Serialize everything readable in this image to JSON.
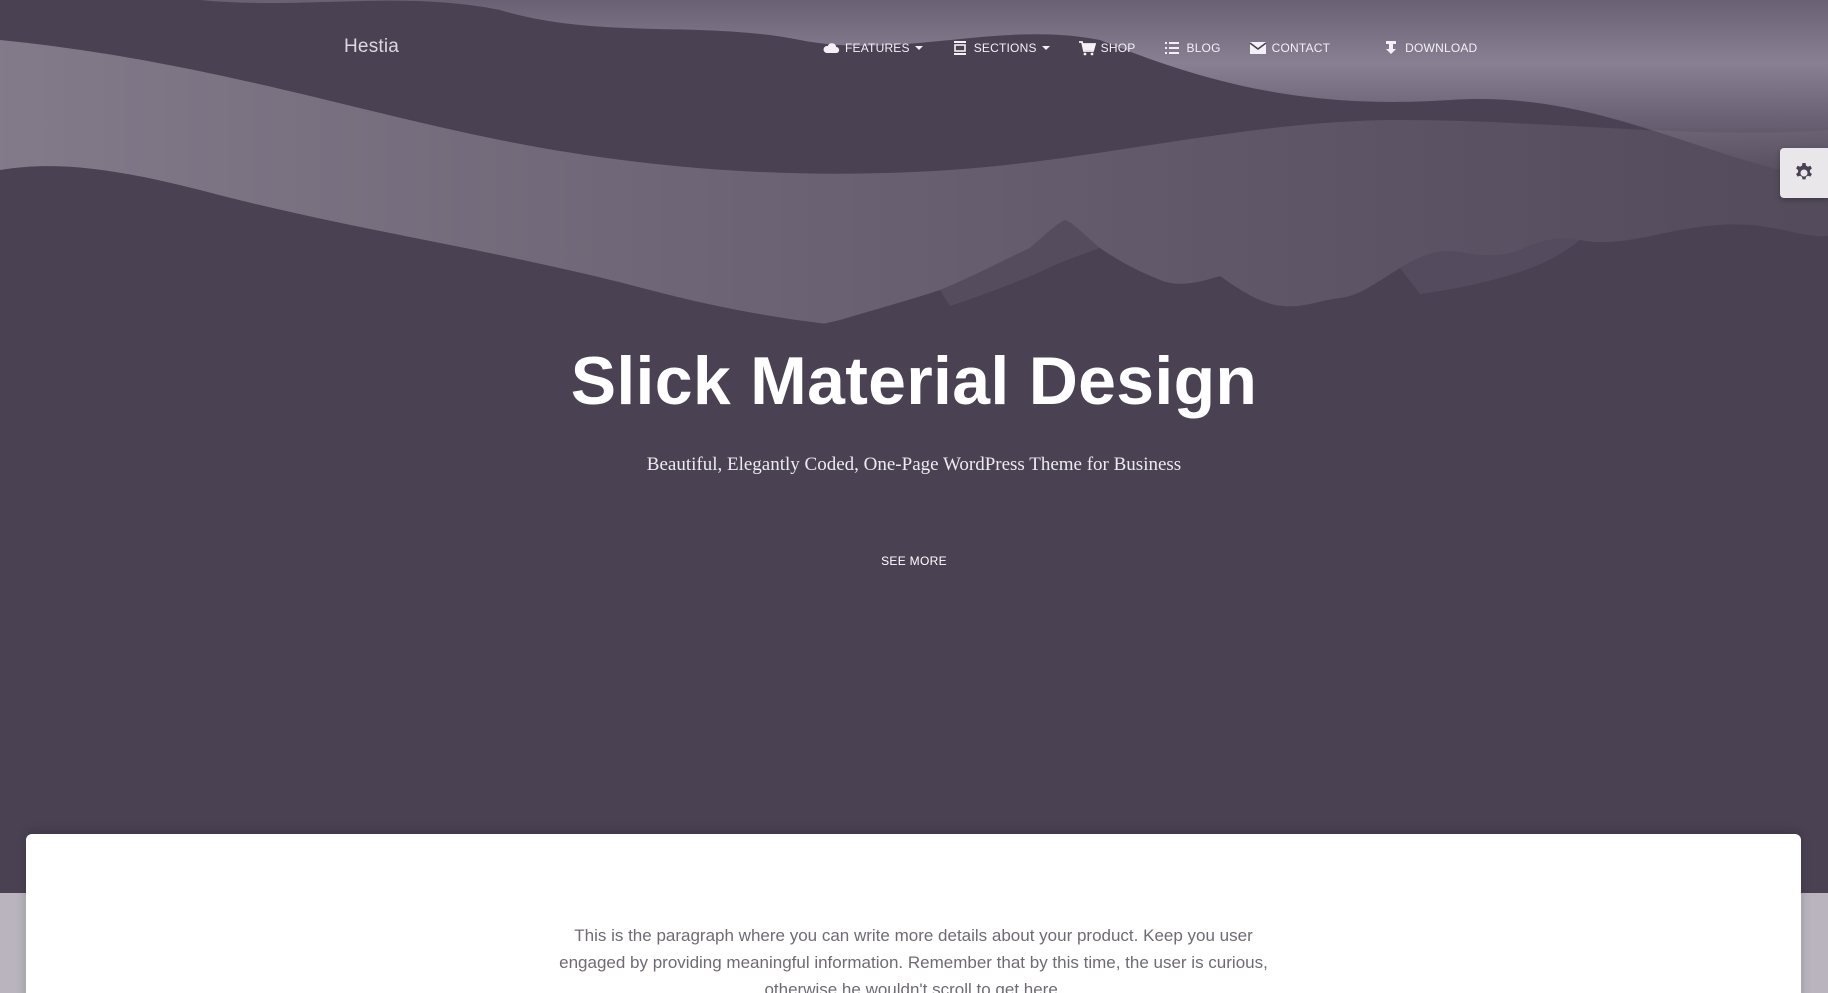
{
  "brand": {
    "name": "Hestia"
  },
  "nav": {
    "items": [
      {
        "label": "FEATURES",
        "icon": "cloud-icon",
        "has_dropdown": true
      },
      {
        "label": "SECTIONS",
        "icon": "sections-icon",
        "has_dropdown": true
      },
      {
        "label": "SHOP",
        "icon": "cart-icon",
        "has_dropdown": false
      },
      {
        "label": "BLOG",
        "icon": "list-icon",
        "has_dropdown": false
      },
      {
        "label": "CONTACT",
        "icon": "envelope-icon",
        "has_dropdown": false
      },
      {
        "label": "DOWNLOAD",
        "icon": "download-icon",
        "has_dropdown": false
      }
    ]
  },
  "settings": {
    "icon": "gear-icon"
  },
  "hero": {
    "title": "Slick Material Design",
    "subtitle": "Beautiful, Elegantly Coded, One-Page WordPress Theme for Business",
    "button_label": "SEE MORE"
  },
  "content": {
    "paragraph_lines": [
      "This is the paragraph where you can write more details about your product. Keep you user",
      "engaged by providing meaningful information. Remember that by this time, the user is curious,",
      "otherwise he wouldn't scroll to get here."
    ]
  },
  "colors": {
    "hero_background": "#4a4152",
    "sky_haze": "#9c94a4",
    "card_background": "#ffffff",
    "text_primary": "#ffffff"
  }
}
